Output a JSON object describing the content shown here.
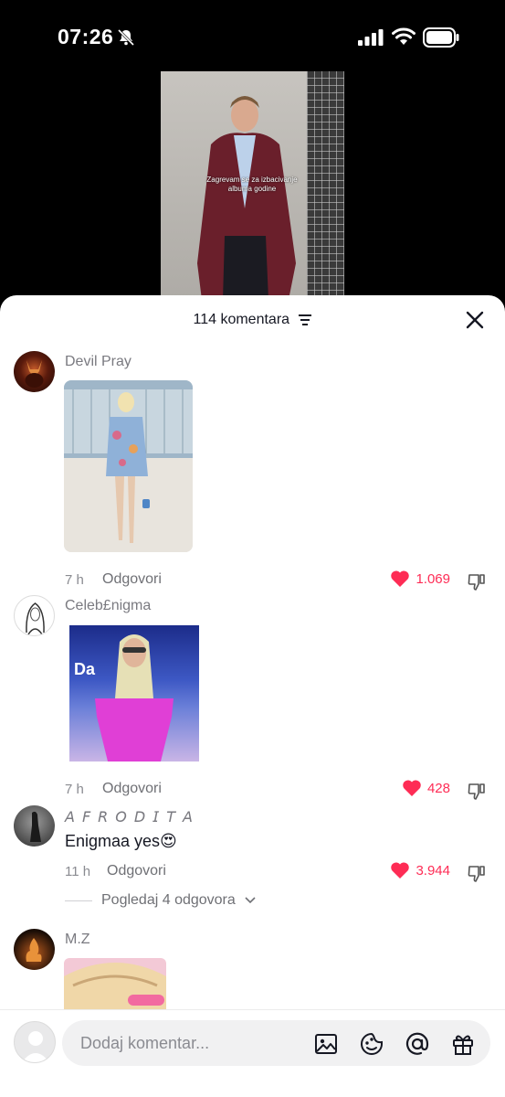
{
  "status_bar": {
    "time": "07:26"
  },
  "video": {
    "caption": "Zagrevam se za izbacivanje albuma godine"
  },
  "comments_sheet": {
    "title": "114 komentara",
    "comments": [
      {
        "username": "Devil Pray",
        "text": "",
        "time": "7 h",
        "reply_label": "Odgovori",
        "likes": "1.069",
        "liked": true
      },
      {
        "username": "Celeb£nigma",
        "image_label": "Da",
        "time": "7 h",
        "reply_label": "Odgovori",
        "likes": "428",
        "liked": true
      },
      {
        "username": "𝘈 𝘍 𝘙 𝘖 𝘋 𝘐 𝘛 𝘈",
        "text": "Enigmaa yes😍",
        "time": "11 h",
        "reply_label": "Odgovori",
        "likes": "3.944",
        "liked": true,
        "view_replies": "Pogledaj 4 odgovora"
      },
      {
        "username": "M.Z"
      }
    ]
  },
  "composer": {
    "placeholder": "Dodaj komentar..."
  },
  "colors": {
    "accent": "#fe2c55",
    "background": "#ffffff",
    "text": "#161823",
    "muted": "#8a8b91"
  }
}
